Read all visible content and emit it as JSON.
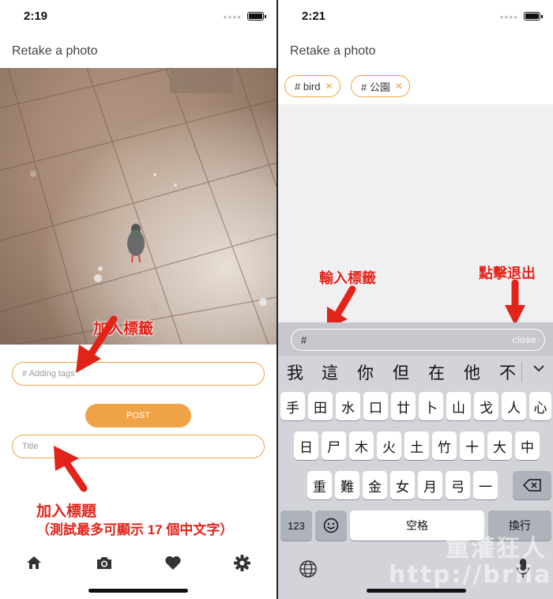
{
  "left": {
    "status": {
      "time": "2:19"
    },
    "nav_title": "Retake a photo",
    "tags_placeholder": "# Adding tags",
    "post_label": "POST",
    "title_placeholder": "Title",
    "tabs": [
      "home-icon",
      "camera-icon",
      "heart-icon",
      "gear-icon"
    ],
    "annotations": {
      "add_tags": "加入標籤",
      "add_title": "加入標題",
      "title_note": "（測試最多可顯示 17 個中文字）"
    }
  },
  "right": {
    "status": {
      "time": "2:21"
    },
    "nav_title": "Retake a photo",
    "chips": [
      {
        "label": "# bird"
      },
      {
        "label": "# 公園"
      }
    ],
    "input_prefix": "#",
    "close_label": "close",
    "annotations": {
      "input_tags": "輸入標籤",
      "tap_to_exit": "點擊退出"
    },
    "candidates": [
      "我",
      "這",
      "你",
      "但",
      "在",
      "他",
      "不"
    ],
    "keyboard": {
      "row1": [
        "手",
        "田",
        "水",
        "口",
        "廿",
        "卜",
        "山",
        "戈",
        "人",
        "心"
      ],
      "row2": [
        "日",
        "尸",
        "木",
        "火",
        "土",
        "竹",
        "十",
        "大",
        "中"
      ],
      "row3": [
        "重",
        "難",
        "金",
        "女",
        "月",
        "弓",
        "一"
      ],
      "num_key": "123",
      "space_key": "空格",
      "return_key": "換行"
    },
    "icons": [
      "backspace-icon",
      "emoji-icon",
      "globe-icon",
      "microphone-icon",
      "chevron-down-icon"
    ]
  },
  "watermark": "重灌狂人 http://briian.com",
  "colors": {
    "accent": "#f0a346",
    "annotation": "#e2231a",
    "keyboard_bg": "#d2d4d9"
  }
}
